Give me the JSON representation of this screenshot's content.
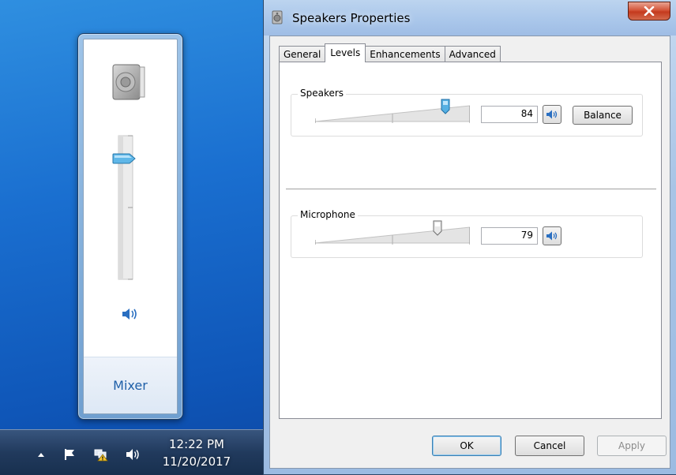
{
  "flyout": {
    "mixer_label": "Mixer",
    "volume_level": 0.84
  },
  "taskbar": {
    "time": "12:22 PM",
    "date": "11/20/2017"
  },
  "window": {
    "title": "Speakers Properties",
    "tabs": [
      {
        "label": "General",
        "active": false
      },
      {
        "label": "Levels",
        "active": true
      },
      {
        "label": "Enhancements",
        "active": false
      },
      {
        "label": "Advanced",
        "active": false
      }
    ],
    "speakers": {
      "label": "Speakers",
      "value": "84",
      "level": 0.84,
      "balance_label": "Balance"
    },
    "microphone": {
      "label": "Microphone",
      "value": "79",
      "level": 0.79
    },
    "buttons": {
      "ok": "OK",
      "cancel": "Cancel",
      "apply": "Apply"
    }
  },
  "colors": {
    "accent": "#1e5fa8",
    "thumb_active": "#49a6de",
    "close_red": "#c43a1e"
  }
}
